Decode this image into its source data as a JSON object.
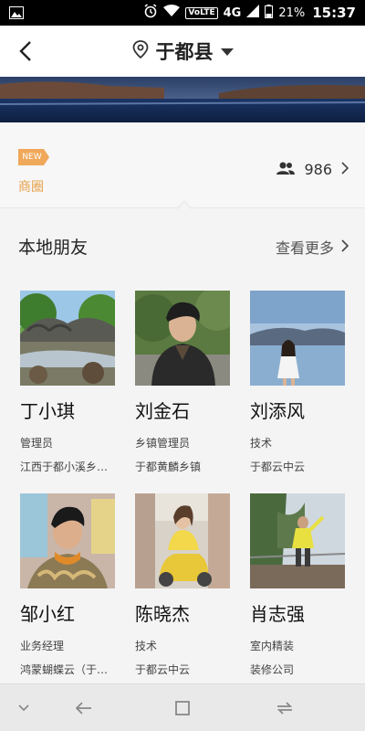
{
  "status_bar": {
    "network_badge": "VoLTE",
    "network_type": "4G",
    "battery": "21%",
    "time": "15:37"
  },
  "header": {
    "location": "于都县"
  },
  "stats": {
    "new_tag": "NEW",
    "biz_circle_label": "商圈",
    "member_count": "986"
  },
  "section": {
    "title": "本地朋友",
    "see_more": "查看更多"
  },
  "friends": [
    {
      "name": "丁小琪",
      "role": "管理员",
      "org": "江西于都小溪乡…"
    },
    {
      "name": "刘金石",
      "role": "乡镇管理员",
      "org": "于都黄麟乡镇"
    },
    {
      "name": "刘添风",
      "role": "技术",
      "org": "于都云中云"
    },
    {
      "name": "邹小红",
      "role": "业务经理",
      "org": "鸿蒙蝴蝶云（于…"
    },
    {
      "name": "陈晓杰",
      "role": "技术",
      "org": "于都云中云"
    },
    {
      "name": "肖志强",
      "role": "室内精装",
      "org": "装修公司"
    }
  ],
  "colors": {
    "accent_orange": "#e6a04a",
    "text_dark": "#222222",
    "background": "#f4f4f4"
  }
}
